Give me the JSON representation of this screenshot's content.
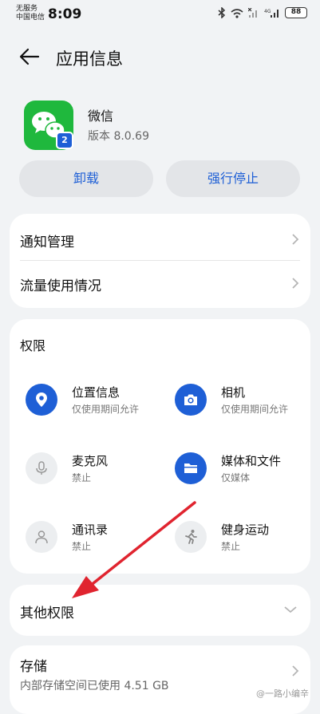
{
  "status_bar": {
    "carrier_line1": "无服务",
    "carrier_line2": "中国电信",
    "time": "8:09",
    "battery": "88"
  },
  "header": {
    "title": "应用信息"
  },
  "app": {
    "name": "微信",
    "version": "版本 8.0.69",
    "badge": "2",
    "icon_color": "#1fb83d"
  },
  "actions": {
    "uninstall": "卸载",
    "force_stop": "强行停止"
  },
  "menu": {
    "notifications": "通知管理",
    "data_usage": "流量使用情况"
  },
  "permissions": {
    "title": "权限",
    "items": [
      {
        "name": "位置信息",
        "status": "仅使用期间允许",
        "icon": "location-icon",
        "enabled": true
      },
      {
        "name": "相机",
        "status": "仅使用期间允许",
        "icon": "camera-icon",
        "enabled": true
      },
      {
        "name": "麦克风",
        "status": "禁止",
        "icon": "microphone-icon",
        "enabled": false
      },
      {
        "name": "媒体和文件",
        "status": "仅媒体",
        "icon": "folder-icon",
        "enabled": true
      },
      {
        "name": "通讯录",
        "status": "禁止",
        "icon": "contacts-icon",
        "enabled": false
      },
      {
        "name": "健身运动",
        "status": "禁止",
        "icon": "running-icon",
        "enabled": false
      }
    ]
  },
  "other_permissions": {
    "label": "其他权限"
  },
  "storage": {
    "title": "存储",
    "subtitle": "内部存储空间已使用 4.51 GB"
  },
  "watermark": "@一路小编辛",
  "colors": {
    "accent": "#1e5fd6",
    "annotation_arrow": "#e0242f"
  }
}
